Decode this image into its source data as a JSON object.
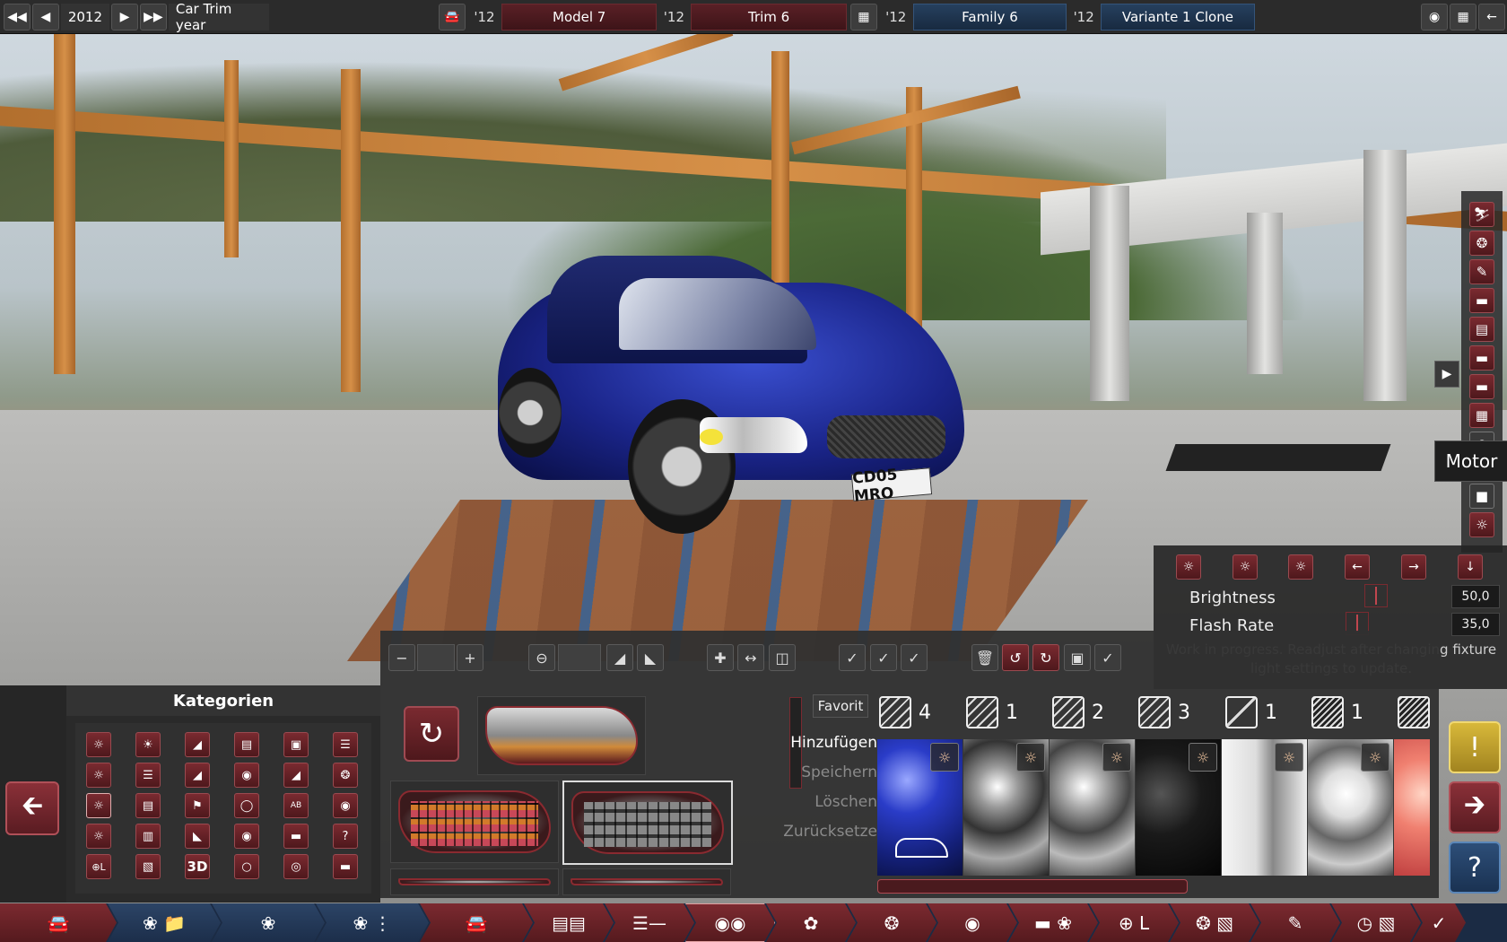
{
  "topbar": {
    "year": "2012",
    "year_label": "Car Trim year",
    "model_year": "'12",
    "model": "Model 7",
    "trim_year": "'12",
    "trim": "Trim 6",
    "family_year": "'12",
    "family": "Family 6",
    "variant_year": "'12",
    "variant": "Variante 1 Clone"
  },
  "scene": {
    "license_plate": "CD05 MRO"
  },
  "right_toolbar": {
    "tooltip": "Motor"
  },
  "light_panel": {
    "brightness_label": "Brightness",
    "brightness_value": "50,0",
    "flash_label": "Flash Rate",
    "flash_value": "35,0",
    "note": "Work in progress. Readjust after changing fixture light settings to update."
  },
  "categories": {
    "title": "Kategorien",
    "btn_3d": "3D"
  },
  "favorites": {
    "fav_label": "Favorit",
    "add": "Hinzufügen",
    "save": "Speichern",
    "delete": "Löschen",
    "reset": "Zurücksetze"
  },
  "materials": {
    "counts": [
      "4",
      "1",
      "2",
      "3",
      "1",
      "1"
    ]
  },
  "colors": {
    "accent_red": "#7a2a30",
    "accent_blue": "#26405e",
    "warning_yellow": "#d8b83a"
  }
}
